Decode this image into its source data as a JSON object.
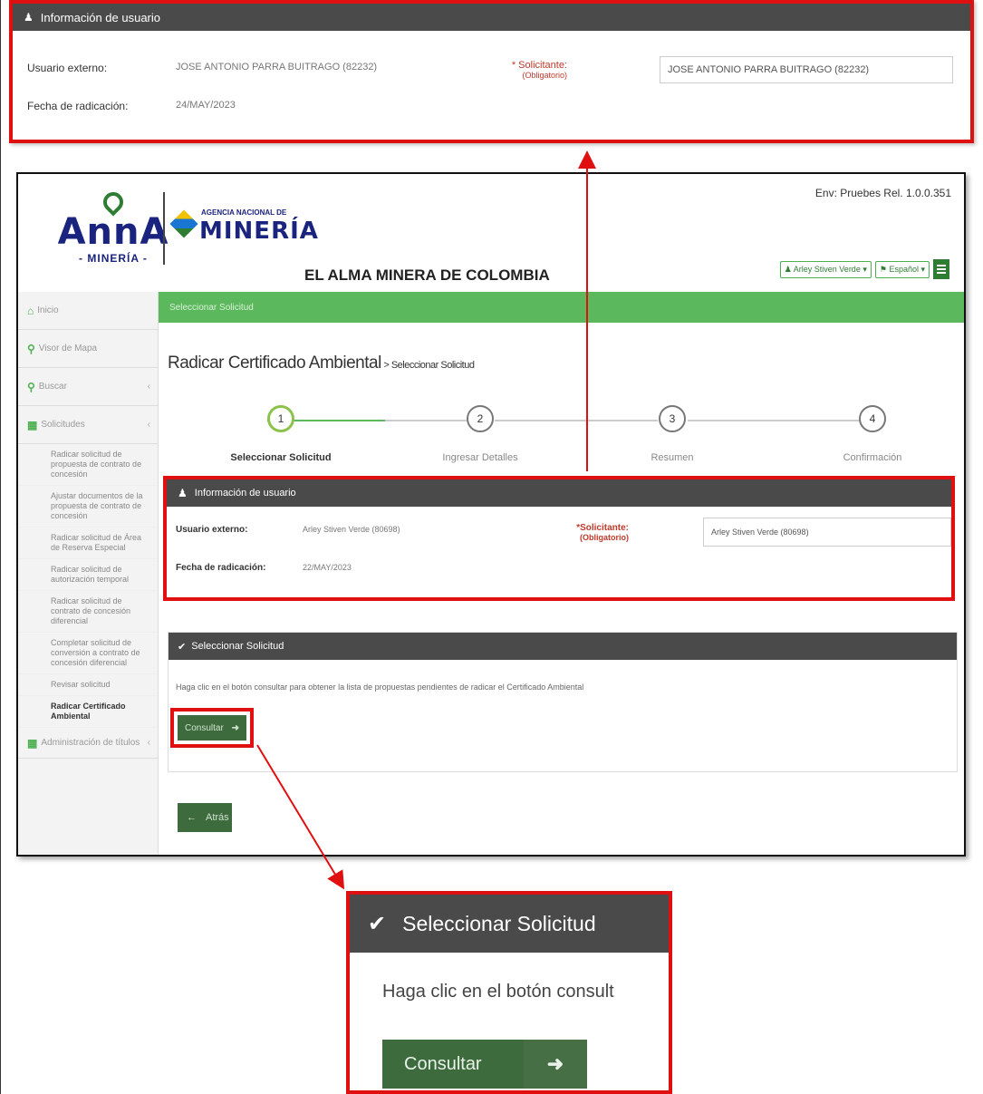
{
  "top_callout": {
    "header": "Información de usuario",
    "external_user_label": "Usuario externo:",
    "external_user_value": "JOSE ANTONIO PARRA BUITRAGO (82232)",
    "filing_date_label": "Fecha de radicación:",
    "filing_date_value": "24/MAY/2023",
    "requester_label": "* Solicitante:",
    "requester_required": "(Obligatorio)",
    "requester_value": "JOSE ANTONIO PARRA BUITRAGO (82232)"
  },
  "header": {
    "logo_word": "AnnA",
    "logo_sub": "- MINERÍA -",
    "agency_small": "AGENCIA NACIONAL DE",
    "agency_big": "MINERÍA",
    "slogan": "EL ALMA MINERA DE COLOMBIA",
    "env": "Env: Pruebes Rel. 1.0.0.351",
    "user_button": "Arley Stiven Verde",
    "lang_button": "Español"
  },
  "sidebar": {
    "items": [
      {
        "icon": "home-icon",
        "label": "Inicio"
      },
      {
        "icon": "map-marker-icon",
        "label": "Visor de Mapa"
      },
      {
        "icon": "search-icon",
        "label": "Buscar"
      },
      {
        "icon": "grid-icon",
        "label": "Solicitudes"
      }
    ],
    "subitems": [
      "Radicar solicitud de propuesta de contrato de concesión",
      "Ajustar documentos de la propuesta de contrato de concesión",
      "Radicar solicitud de Área de Reserva Especial",
      "Radicar solicitud de autorización temporal",
      "Radicar solicitud de contrato de concesión diferencial",
      "Completar solicitud de conversión a contrato de concesión diferencial",
      "Revisar solicitud",
      "Radicar Certificado Ambiental"
    ],
    "last_item": "Administración de títulos"
  },
  "breadcrumb": "Seleccionar Solicitud",
  "page_title": "Radicar Certificado Ambiental",
  "page_subtitle": " > Seleccionar Solicitud",
  "steps": [
    {
      "num": "1",
      "label": "Seleccionar Solicitud"
    },
    {
      "num": "2",
      "label": "Ingresar Detalles"
    },
    {
      "num": "3",
      "label": "Resumen"
    },
    {
      "num": "4",
      "label": "Confirmación"
    }
  ],
  "user_info": {
    "header": "Información de usuario",
    "external_user_label": "Usuario externo:",
    "external_user_value": "Arley Stiven Verde (80698)",
    "filing_date_label": "Fecha de radicación:",
    "filing_date_value": "22/MAY/2023",
    "requester_label": "*Solicitante:",
    "requester_required": "(Obligatorio)",
    "requester_value": "Arley Stiven Verde (80698)"
  },
  "select_panel": {
    "header": "Seleccionar Solicitud",
    "text": "Haga clic en el botón consultar para obtener la lista de propuestas pendientes de radicar el Certificado Ambiental",
    "consult_button": "Consultar"
  },
  "back_button": "Atrás",
  "bottom_callout": {
    "header": "Seleccionar Solicitud",
    "text": "Haga clic en el botón consult",
    "button": "Consultar"
  },
  "colors": {
    "accent_green": "#5cb85c",
    "dark_green": "#3d6b3d",
    "callout_red": "#e01010",
    "header_gray": "#4a4a4a"
  }
}
